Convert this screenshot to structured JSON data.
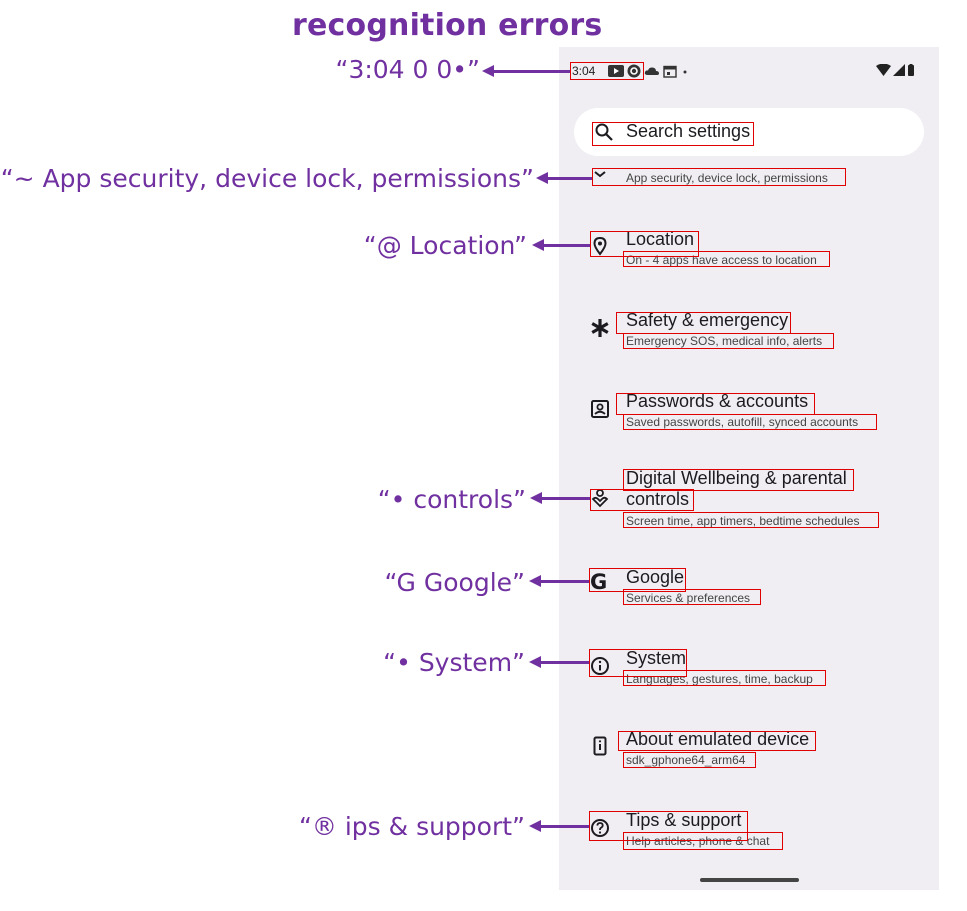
{
  "heading": "recognition errors",
  "status_bar": {
    "time": "3:04",
    "icons": [
      "youtube-icon",
      "settings-sync-icon",
      "cloud-icon",
      "calendar-icon",
      "dot-icon"
    ],
    "right_icons": [
      "wifi-icon",
      "signal-icon",
      "battery-icon"
    ]
  },
  "search": {
    "placeholder": "Search settings"
  },
  "settings": {
    "items": [
      {
        "title": "",
        "subtitle": "App security, device lock, permissions",
        "icon": "chevron-icon"
      },
      {
        "title": "Location",
        "subtitle": "On - 4 apps have access to location",
        "icon": "location-pin-icon"
      },
      {
        "title": "Safety & emergency",
        "subtitle": "Emergency SOS, medical info, alerts",
        "icon": "asterisk-icon"
      },
      {
        "title": "Passwords & accounts",
        "subtitle": "Saved passwords, autofill, synced accounts",
        "icon": "account-box-icon"
      },
      {
        "title_line1": "Digital Wellbeing & parental",
        "title_line2": "controls",
        "subtitle": "Screen time, app timers, bedtime schedules",
        "icon": "wellbeing-icon"
      },
      {
        "title": "Google",
        "subtitle": "Services & preferences",
        "icon": "google-icon"
      },
      {
        "title": "System",
        "subtitle": "Languages, gestures, time, backup",
        "icon": "info-icon"
      },
      {
        "title": "About emulated device",
        "subtitle": "sdk_gphone64_arm64",
        "icon": "device-info-icon"
      },
      {
        "title": "Tips & support",
        "subtitle": "Help articles, phone & chat",
        "icon": "help-icon"
      }
    ]
  },
  "annotations": [
    "“3:04 0 0•”",
    "“~ App security, device lock, permissions”",
    "“@ Location”",
    "“• controls”",
    "“G Google”",
    "“• System”",
    "“® ips & support”"
  ],
  "colors": {
    "annotation": "#7030a0",
    "box": "#e00000",
    "screen_bg": "#f0eef2"
  }
}
